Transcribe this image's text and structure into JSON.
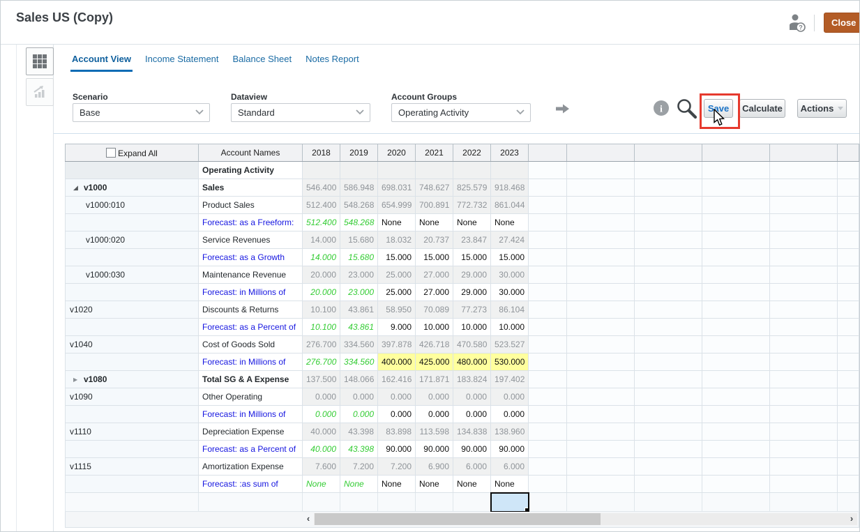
{
  "window": {
    "title": "Sales US (Copy)",
    "close_label": "Close"
  },
  "tabs": [
    {
      "label": "Account View",
      "active": true
    },
    {
      "label": "Income Statement",
      "active": false
    },
    {
      "label": "Balance Sheet",
      "active": false
    },
    {
      "label": "Notes Report",
      "active": false
    }
  ],
  "filters": {
    "scenario": {
      "label": "Scenario",
      "value": "Base"
    },
    "dataview": {
      "label": "Dataview",
      "value": "Standard"
    },
    "account_groups": {
      "label": "Account Groups",
      "value": "Operating Activity"
    }
  },
  "toolbar": {
    "save_label": "Save",
    "calculate_label": "Calculate",
    "actions_label": "Actions"
  },
  "table": {
    "expand_all_label": "Expand All",
    "columns": [
      "Account Names",
      "2018",
      "2019",
      "2020",
      "2021",
      "2022",
      "2023"
    ],
    "rows": [
      {
        "type": "group-header",
        "code": "",
        "name": "Operating Activity",
        "bold": true,
        "values": [
          "",
          "",
          "",
          "",
          "",
          ""
        ]
      },
      {
        "type": "parent",
        "toggle": "expanded",
        "code": "v1000",
        "name": "Sales",
        "bold": true,
        "values": [
          "546.400",
          "586.948",
          "698.031",
          "748.627",
          "825.579",
          "918.468"
        ]
      },
      {
        "type": "child",
        "code": "v1000:010",
        "name": "Product Sales",
        "values": [
          "512.400",
          "548.268",
          "654.999",
          "700.891",
          "772.732",
          "861.044"
        ]
      },
      {
        "type": "forecast",
        "code": "",
        "name": "Forecast: as a Freeform:",
        "values": [
          "512.400",
          "548.268",
          "None",
          "None",
          "None",
          "None"
        ]
      },
      {
        "type": "child",
        "code": "v1000:020",
        "name": "Service Revenues",
        "values": [
          "14.000",
          "15.680",
          "18.032",
          "20.737",
          "23.847",
          "27.424"
        ]
      },
      {
        "type": "forecast",
        "code": "",
        "name": "Forecast: as a Growth",
        "values": [
          "14.000",
          "15.680",
          "15.000",
          "15.000",
          "15.000",
          "15.000"
        ]
      },
      {
        "type": "child",
        "code": "v1000:030",
        "name": "Maintenance Revenue",
        "values": [
          "20.000",
          "23.000",
          "25.000",
          "27.000",
          "29.000",
          "30.000"
        ]
      },
      {
        "type": "forecast",
        "code": "",
        "name": "Forecast: in Millions of",
        "values": [
          "20.000",
          "23.000",
          "25.000",
          "27.000",
          "29.000",
          "30.000"
        ]
      },
      {
        "type": "leaf",
        "code": "v1020",
        "name": "Discounts & Returns",
        "values": [
          "10.100",
          "43.861",
          "58.950",
          "70.089",
          "77.273",
          "86.104"
        ]
      },
      {
        "type": "forecast",
        "code": "",
        "name": "Forecast: as a Percent of",
        "values": [
          "10.100",
          "43.861",
          "9.000",
          "10.000",
          "10.000",
          "10.000"
        ]
      },
      {
        "type": "leaf",
        "code": "v1040",
        "name": "Cost of Goods Sold",
        "values": [
          "276.700",
          "334.560",
          "397.878",
          "426.718",
          "470.580",
          "523.527"
        ]
      },
      {
        "type": "forecast",
        "highlight": true,
        "code": "",
        "name": "Forecast: in Millions of",
        "values": [
          "276.700",
          "334.560",
          "400.000",
          "425.000",
          "480.000",
          "530.000"
        ]
      },
      {
        "type": "parent",
        "toggle": "collapsed",
        "code": "v1080",
        "name": "Total SG & A Expense",
        "bold": true,
        "values": [
          "137.500",
          "148.066",
          "162.416",
          "171.871",
          "183.824",
          "197.402"
        ]
      },
      {
        "type": "leaf",
        "code": "v1090",
        "name": "Other Operating",
        "values": [
          "0.000",
          "0.000",
          "0.000",
          "0.000",
          "0.000",
          "0.000"
        ]
      },
      {
        "type": "forecast",
        "code": "",
        "name": "Forecast: in Millions of",
        "values": [
          "0.000",
          "0.000",
          "0.000",
          "0.000",
          "0.000",
          "0.000"
        ]
      },
      {
        "type": "leaf",
        "code": "v1110",
        "name": "Depreciation Expense",
        "values": [
          "40.000",
          "43.398",
          "83.898",
          "113.598",
          "134.838",
          "138.960"
        ]
      },
      {
        "type": "forecast",
        "code": "",
        "name": "Forecast: as a Percent of",
        "values": [
          "40.000",
          "43.398",
          "90.000",
          "90.000",
          "90.000",
          "90.000"
        ]
      },
      {
        "type": "leaf",
        "code": "v1115",
        "name": "Amortization Expense",
        "values": [
          "7.600",
          "7.200",
          "7.200",
          "6.900",
          "6.000",
          "6.000"
        ]
      },
      {
        "type": "forecast",
        "code": "",
        "name": "Forecast: :as sum of",
        "values": [
          "None",
          "None",
          "None",
          "None",
          "None",
          "None"
        ]
      },
      {
        "type": "empty",
        "code": "",
        "name": "",
        "values": [
          "",
          "",
          "",
          "",
          "",
          ""
        ],
        "selected_col": 5
      }
    ]
  },
  "icons": {
    "user_help": "user-assistance-icon",
    "grid_view": "grid-view-icon",
    "chart_view": "chart-view-icon",
    "next_arrow": "next-arrow-icon",
    "info": "info-icon",
    "search": "search-icon",
    "cursor": "mouse-cursor"
  },
  "colors": {
    "tab_blue": "#0f6cb5",
    "year_link_blue": "#2626cf",
    "forecast_link_blue": "#1515e0",
    "forecast_green": "#33cc33",
    "highlight_yellow": "#ffff9e",
    "close_orange": "#b35c26",
    "annotation_red": "#e63a2e",
    "selected_cell_blue": "#cfe6f8"
  }
}
